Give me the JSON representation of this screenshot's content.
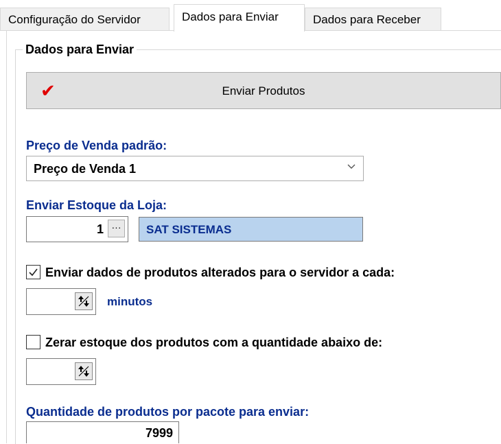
{
  "tabs": [
    {
      "label": "Configuração do Servidor",
      "active": false
    },
    {
      "label": "Dados para Enviar",
      "active": true
    },
    {
      "label": "Dados para Receber",
      "active": false
    }
  ],
  "group": {
    "title": "Dados para Enviar",
    "send_button": {
      "label": "Enviar Produtos",
      "icon": "checkmark-icon",
      "icon_color": "#e00000"
    }
  },
  "price": {
    "label": "Preço de Venda padrão:",
    "selected": "Preço de Venda 1"
  },
  "stock": {
    "label": "Enviar Estoque da Loja:",
    "store_code": "1",
    "lookup_label": "···",
    "store_name": "SAT SISTEMAS"
  },
  "auto_send": {
    "checked": true,
    "label": "Enviar dados de produtos alterados para o servidor a cada:",
    "interval_value": "",
    "unit": "minutos"
  },
  "zero_stock": {
    "checked": false,
    "label": "Zerar estoque dos produtos com a quantidade abaixo de:",
    "threshold_value": ""
  },
  "package": {
    "label": "Quantidade de produtos por pacote para enviar:",
    "value": "7999"
  },
  "colors": {
    "label_blue": "#0a2d8f",
    "selection_bg": "#b9d3ee",
    "check_red": "#e00000"
  }
}
